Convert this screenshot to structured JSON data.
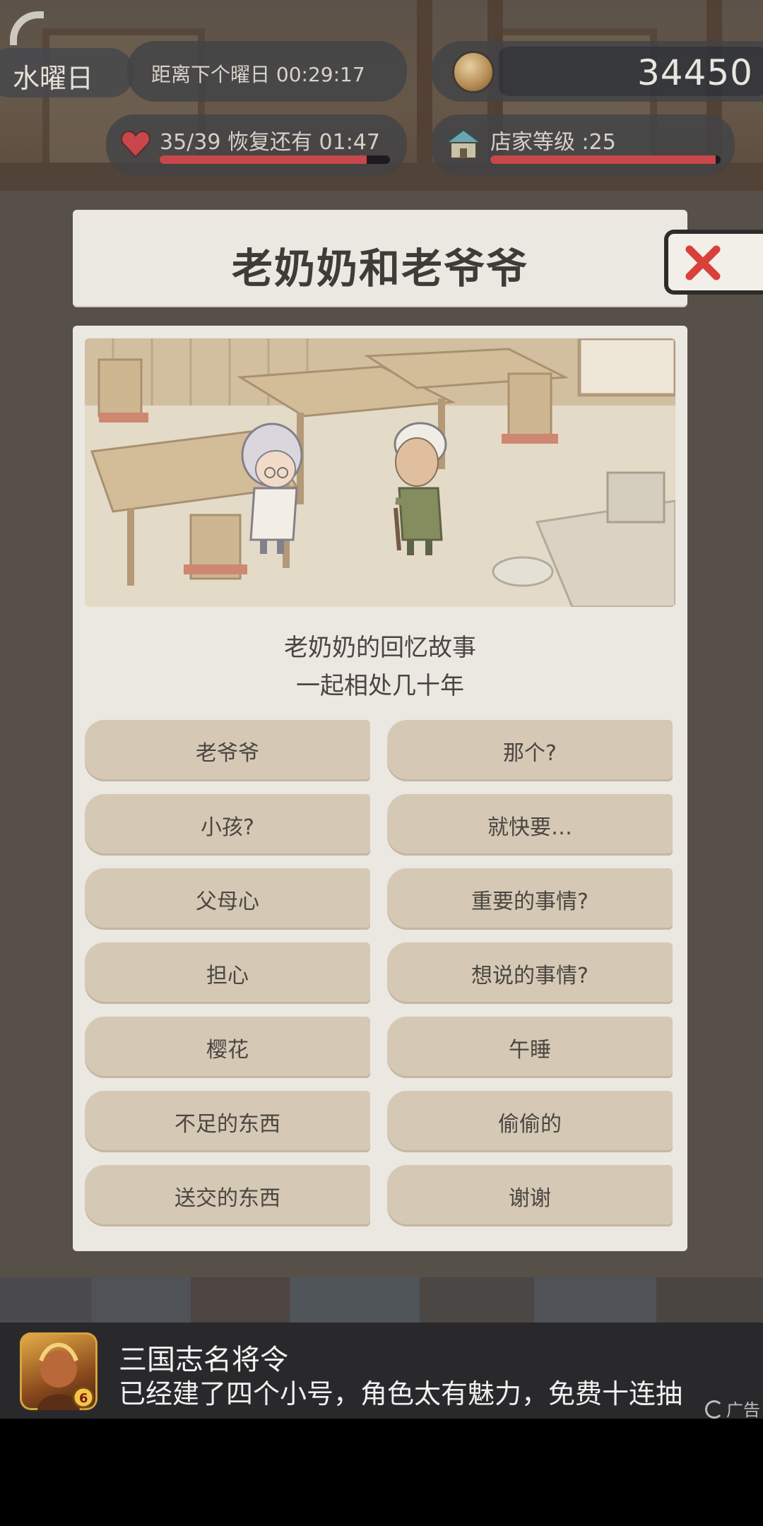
{
  "hud": {
    "day_label": "水曜日",
    "timer_label": "距离下个曜日 00:29:17",
    "coins": "34450",
    "hearts_text": "35/39  恢复还有  01:47",
    "hearts_progress": 0.9,
    "shop_level_text": "店家等级 :25",
    "shop_progress": 0.98,
    "icons": {
      "corner": "refresh-arc-icon",
      "coin": "coin-icon",
      "heart": "heart-icon",
      "shop": "shop-icon"
    }
  },
  "dialog": {
    "title": "老奶奶和老爷爷",
    "close_icon": "close-icon",
    "story_line_1": "老奶奶的回忆故事",
    "story_line_2": "一起相处几十年",
    "options": [
      "老爷爷",
      "那个?",
      "小孩?",
      "就快要…",
      "父母心",
      "重要的事情?",
      "担心",
      "想说的事情?",
      "樱花",
      "午睡",
      "不足的东西",
      "偷偷的",
      "送交的东西",
      "谢谢"
    ]
  },
  "ad": {
    "title": "三国志名将令",
    "description": "已经建了四个小号，角色太有魅力，免费十连抽",
    "label": "广告"
  },
  "colors": {
    "accent_red": "#c8474a",
    "card_bg": "#ebe7e1",
    "option_bg": "#d5c9b6",
    "close_x": "#d9403a"
  }
}
